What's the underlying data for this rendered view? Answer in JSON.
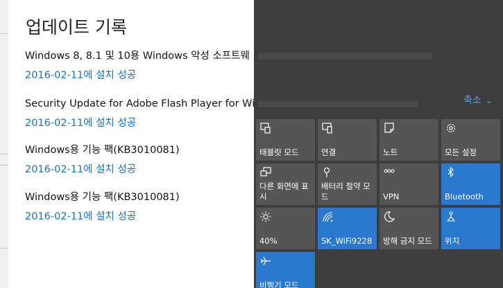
{
  "history": {
    "title": "업데이트 기록",
    "updates": [
      {
        "name": "Windows 8, 8.1 및 10용 Windows 악성 소프트웨",
        "status": "2016-02-11에 설치 성공"
      },
      {
        "name": "Security Update for Adobe Flash Player for Windo",
        "status": "2016-02-11에 설치 성공"
      },
      {
        "name": "Windows용 기능 팩(KB3010081)",
        "status": "2016-02-11에 설치 성공"
      },
      {
        "name": "Windows용 기능 팩(KB3010081)",
        "status": "2016-02-11에 설치 성공"
      }
    ]
  },
  "action_center": {
    "collapse_label": "축소",
    "tiles": [
      {
        "label": "태블릿 모드",
        "icon": "tablet-mode-icon",
        "active": false
      },
      {
        "label": "연결",
        "icon": "connect-icon",
        "active": false
      },
      {
        "label": "노트",
        "icon": "note-icon",
        "active": false
      },
      {
        "label": "모든 설정",
        "icon": "gear-icon",
        "active": false
      },
      {
        "label": "다른 화면에 표시",
        "icon": "project-icon",
        "active": false
      },
      {
        "label": "배터리 절약 모드",
        "icon": "battery-saver-icon",
        "active": false
      },
      {
        "label": "VPN",
        "icon": "vpn-icon",
        "active": false
      },
      {
        "label": "Bluetooth",
        "icon": "bluetooth-icon",
        "active": true
      },
      {
        "label": "40%",
        "icon": "brightness-icon",
        "active": false
      },
      {
        "label": "SK_WiFi9228",
        "icon": "wifi-icon",
        "active": true
      },
      {
        "label": "방해 금지 모드",
        "icon": "quiet-hours-icon",
        "active": false
      },
      {
        "label": "위치",
        "icon": "location-icon",
        "active": true
      },
      {
        "label": "비행기 모드",
        "icon": "airplane-icon",
        "active": true
      }
    ]
  },
  "colors": {
    "link": "#1a6fc2",
    "action_center_bg": "#3d3d3d",
    "tile_inactive": "#555555",
    "tile_active": "#2b79cf"
  }
}
